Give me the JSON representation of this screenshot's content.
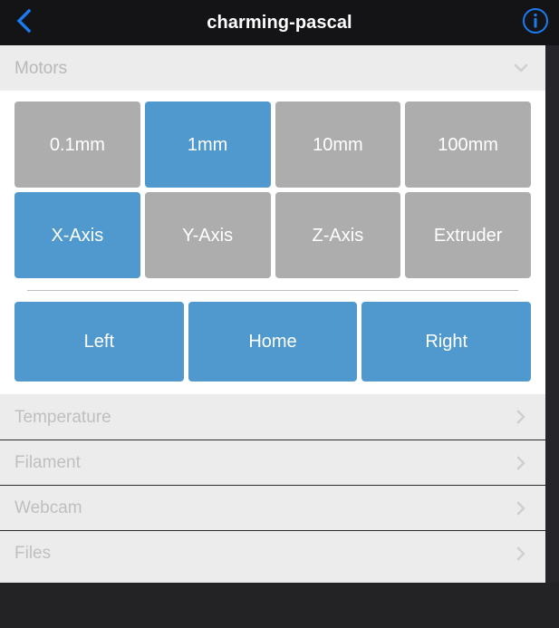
{
  "navbar": {
    "title": "charming-pascal",
    "back_icon": "chevron-left-icon",
    "info_icon": "info-circle-icon",
    "accent_color": "#1a7bf2",
    "background": "#141416"
  },
  "motors_section": {
    "label": "Motors",
    "expanded": true,
    "chevron_icon": "chevron-down-icon",
    "step_sizes": [
      {
        "label": "0.1mm",
        "selected": false
      },
      {
        "label": "1mm",
        "selected": true
      },
      {
        "label": "10mm",
        "selected": false
      },
      {
        "label": "100mm",
        "selected": false
      }
    ],
    "axes": [
      {
        "label": "X-Axis",
        "selected": true
      },
      {
        "label": "Y-Axis",
        "selected": false
      },
      {
        "label": "Z-Axis",
        "selected": false
      },
      {
        "label": "Extruder",
        "selected": false
      }
    ],
    "movement_buttons": [
      {
        "label": "Left"
      },
      {
        "label": "Home"
      },
      {
        "label": "Right"
      }
    ]
  },
  "collapsed_sections": [
    {
      "label": "Temperature",
      "chevron_icon": "chevron-right-icon"
    },
    {
      "label": "Filament",
      "chevron_icon": "chevron-right-icon"
    },
    {
      "label": "Webcam",
      "chevron_icon": "chevron-right-icon"
    },
    {
      "label": "Files",
      "chevron_icon": "chevron-right-icon"
    }
  ],
  "colors": {
    "accent_blue": "#5099ce",
    "inactive_grey": "#adadad",
    "panel_grey": "#ececec",
    "dark_chrome": "#232326"
  }
}
